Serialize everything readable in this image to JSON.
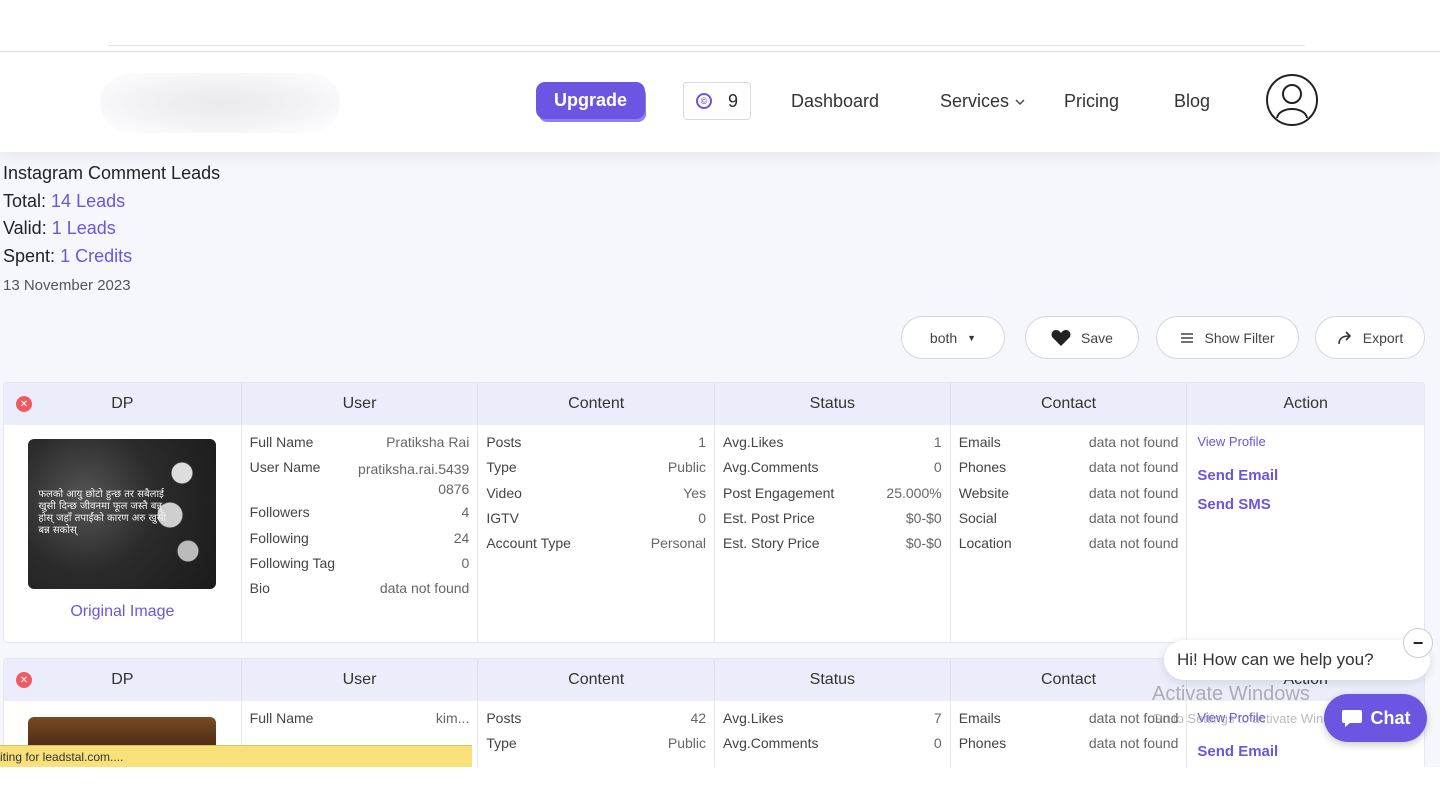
{
  "nav": {
    "upgrade_label": "Upgrade",
    "credits_count": "9",
    "links": [
      "Dashboard",
      "Services",
      "Pricing",
      "Blog"
    ]
  },
  "summary": {
    "title": "Instagram Comment Leads",
    "total_label": "Total:",
    "total_value": "14 Leads",
    "valid_label": "Valid:",
    "valid_value": "1 Leads",
    "spent_label": "Spent:",
    "spent_value": "1 Credits",
    "date": "13 November 2023"
  },
  "toolbar": {
    "filter_select": "both",
    "save_label": "Save",
    "show_filter_label": "Show Filter",
    "export_label": "Export"
  },
  "columns": [
    "DP",
    "User",
    "Content",
    "Status",
    "Contact",
    "Action"
  ],
  "leads": [
    {
      "dp_link": "Original Image",
      "dp_caption": "फलको आयु छोटो हुन्छ तर सबैलाई खुसी दिन्छ जीवनमा फूल जस्तै बन्नु होस् जहाँ तपाईंको कारण अरु खुसी बन्न सकोस्",
      "user": [
        {
          "k": "Full Name",
          "v": "Pratiksha Rai"
        },
        {
          "k": "User Name",
          "v": "pratiksha.rai.54390876"
        },
        {
          "k": "Followers",
          "v": "4"
        },
        {
          "k": "Following",
          "v": "24"
        },
        {
          "k": "Following Tag",
          "v": "0"
        },
        {
          "k": "Bio",
          "v": "data not found"
        }
      ],
      "content": [
        {
          "k": "Posts",
          "v": "1"
        },
        {
          "k": "Type",
          "v": "Public"
        },
        {
          "k": "Video",
          "v": "Yes"
        },
        {
          "k": "IGTV",
          "v": "0"
        },
        {
          "k": "Account Type",
          "v": "Personal"
        }
      ],
      "status": [
        {
          "k": "Avg.Likes",
          "v": "1"
        },
        {
          "k": "Avg.Comments",
          "v": "0"
        },
        {
          "k": "Post Engagement",
          "v": "25.000%"
        },
        {
          "k": "Est. Post Price",
          "v": "$0-$0"
        },
        {
          "k": "Est. Story Price",
          "v": "$0-$0"
        }
      ],
      "contact": [
        {
          "k": "Emails",
          "v": "data not found"
        },
        {
          "k": "Phones",
          "v": "data not found"
        },
        {
          "k": "Website",
          "v": "data not found"
        },
        {
          "k": "Social",
          "v": "data not found"
        },
        {
          "k": "Location",
          "v": "data not found"
        }
      ],
      "actions": [
        "View Profile",
        "Send Email",
        "Send SMS"
      ]
    },
    {
      "user": [
        {
          "k": "Full Name",
          "v": "kim..."
        }
      ],
      "content": [
        {
          "k": "Posts",
          "v": "42"
        },
        {
          "k": "Type",
          "v": "Public"
        }
      ],
      "status": [
        {
          "k": "Avg.Likes",
          "v": "7"
        },
        {
          "k": "Avg.Comments",
          "v": "0"
        }
      ],
      "contact": [
        {
          "k": "Emails",
          "v": "data not found"
        },
        {
          "k": "Phones",
          "v": "data not found"
        }
      ],
      "actions": [
        "View Profile",
        "Send Email"
      ]
    }
  ],
  "browser_status": "iting for leadstal.com....",
  "chat": {
    "greeting": "Hi! How can we help you?",
    "minimize": "−",
    "button_label": "Chat"
  },
  "watermark": {
    "line1": "Activate Windows",
    "line2": "Go to Settings to activate Windows."
  },
  "colors": {
    "accent": "#6c55e0",
    "header_bg": "#ecedfb",
    "page_bg": "#f6f7fd",
    "danger": "#ef5b62",
    "status_bar": "#f8e17a"
  }
}
